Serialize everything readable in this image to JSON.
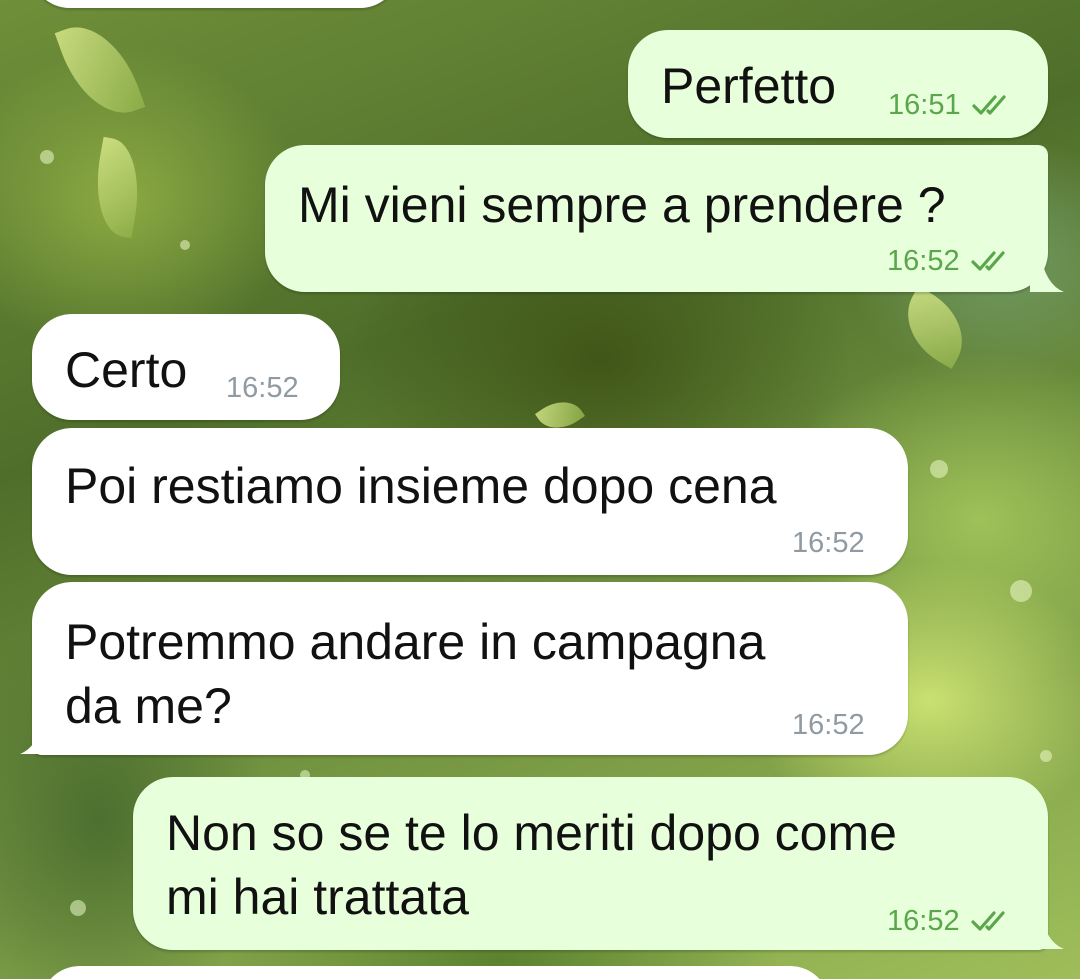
{
  "chat": {
    "messages": [
      {
        "id": "m1",
        "direction": "outgoing",
        "text": "Perfetto",
        "time": "16:51",
        "status_icon": "double-check-icon"
      },
      {
        "id": "m2",
        "direction": "outgoing",
        "text": "Mi vieni sempre a prendere ?",
        "time": "16:52",
        "status_icon": "double-check-icon"
      },
      {
        "id": "m3",
        "direction": "incoming",
        "text": "Certo",
        "time": "16:52"
      },
      {
        "id": "m4",
        "direction": "incoming",
        "text": "Poi restiamo insieme dopo cena",
        "time": "16:52"
      },
      {
        "id": "m5",
        "direction": "incoming",
        "text": "Potremmo andare in campagna\nda me?",
        "time": "16:52"
      },
      {
        "id": "m6",
        "direction": "outgoing",
        "text": "Non so se te lo meriti dopo come\nmi hai trattata",
        "time": "16:52",
        "status_icon": "double-check-icon"
      }
    ]
  },
  "colors": {
    "outgoing_bubble": "#e7ffdb",
    "incoming_bubble": "#ffffff",
    "outgoing_meta": "#5aa64a",
    "incoming_meta": "#8f9aa2"
  }
}
